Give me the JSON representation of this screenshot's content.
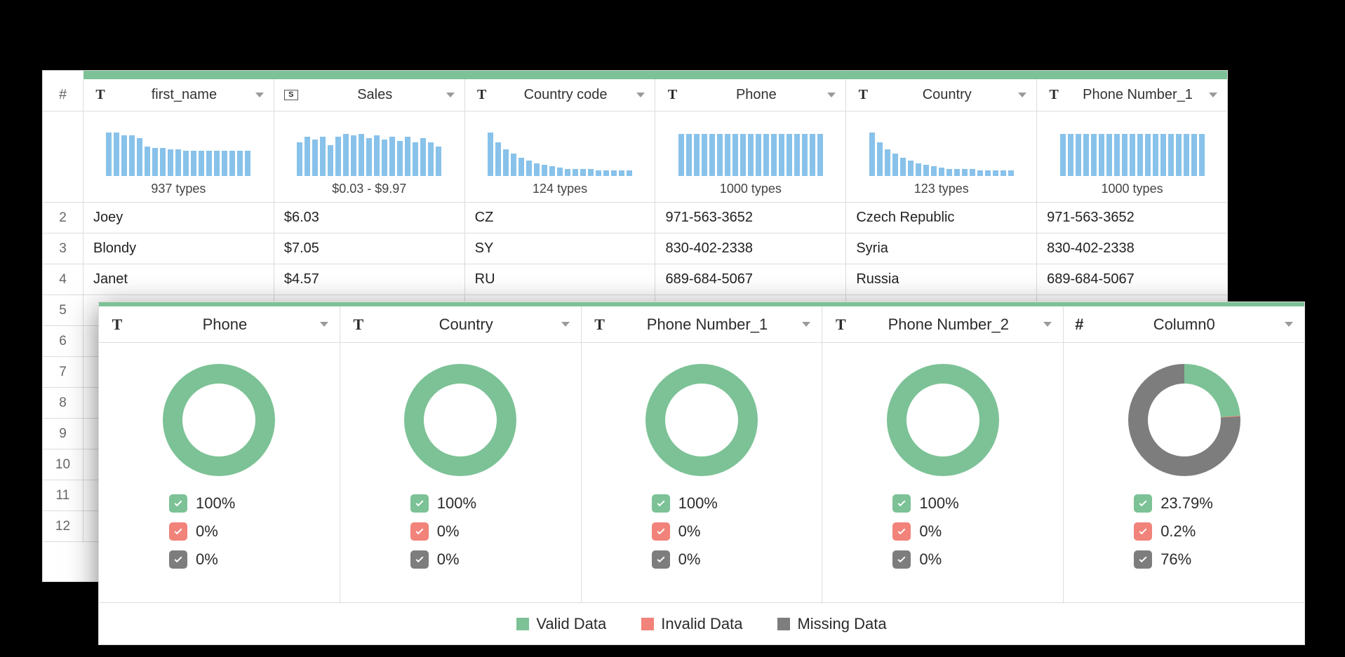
{
  "back": {
    "hash": "#",
    "columns": [
      {
        "type": "T",
        "name": "first_name",
        "hist": [
          62,
          62,
          58,
          58,
          54,
          42,
          40,
          40,
          38,
          38,
          36,
          36,
          36,
          36,
          36,
          36,
          36,
          36,
          36
        ],
        "label": "937 types"
      },
      {
        "type": "S",
        "name": "Sales",
        "hist": [
          48,
          56,
          52,
          56,
          44,
          56,
          60,
          58,
          60,
          54,
          58,
          52,
          56,
          50,
          56,
          48,
          54,
          48,
          42
        ],
        "label": "$0.03 - $9.97"
      },
      {
        "type": "T",
        "name": "Country code",
        "hist": [
          62,
          48,
          38,
          32,
          26,
          22,
          18,
          16,
          14,
          12,
          10,
          10,
          10,
          10,
          8,
          8,
          8,
          8,
          8
        ],
        "label": "124 types"
      },
      {
        "type": "T",
        "name": "Phone",
        "hist": [
          60,
          60,
          60,
          60,
          60,
          60,
          60,
          60,
          60,
          60,
          60,
          60,
          60,
          60,
          60,
          60,
          60,
          60,
          60
        ],
        "label": "1000 types"
      },
      {
        "type": "T",
        "name": "Country",
        "hist": [
          62,
          48,
          38,
          32,
          26,
          22,
          18,
          16,
          14,
          12,
          10,
          10,
          10,
          10,
          8,
          8,
          8,
          8,
          8
        ],
        "label": "123 types"
      },
      {
        "type": "T",
        "name": "Phone Number_1",
        "hist": [
          60,
          60,
          60,
          60,
          60,
          60,
          60,
          60,
          60,
          60,
          60,
          60,
          60,
          60,
          60,
          60,
          60,
          60,
          60
        ],
        "label": "1000 types"
      }
    ],
    "rows": [
      {
        "n": "2",
        "cells": [
          "Joey",
          "$6.03",
          "CZ",
          "971-563-3652",
          "Czech Republic",
          "971-563-3652"
        ]
      },
      {
        "n": "3",
        "cells": [
          "Blondy",
          "$7.05",
          "SY",
          "830-402-2338",
          "Syria",
          "830-402-2338"
        ]
      },
      {
        "n": "4",
        "cells": [
          "Janet",
          "$4.57",
          "RU",
          "689-684-5067",
          "Russia",
          "689-684-5067"
        ]
      }
    ],
    "emptyRows": [
      "5",
      "6",
      "7",
      "8",
      "9",
      "10",
      "11",
      "12"
    ]
  },
  "front": {
    "columns": [
      {
        "type": "T",
        "name": "Phone",
        "valid": 100,
        "invalid": 0,
        "missing": 0,
        "validLabel": "100%",
        "invalidLabel": "0%",
        "missingLabel": "0%"
      },
      {
        "type": "T",
        "name": "Country",
        "valid": 100,
        "invalid": 0,
        "missing": 0,
        "validLabel": "100%",
        "invalidLabel": "0%",
        "missingLabel": "0%"
      },
      {
        "type": "T",
        "name": "Phone Number_1",
        "valid": 100,
        "invalid": 0,
        "missing": 0,
        "validLabel": "100%",
        "invalidLabel": "0%",
        "missingLabel": "0%"
      },
      {
        "type": "T",
        "name": "Phone Number_2",
        "valid": 100,
        "invalid": 0,
        "missing": 0,
        "validLabel": "100%",
        "invalidLabel": "0%",
        "missingLabel": "0%"
      },
      {
        "type": "#",
        "name": "Column0",
        "valid": 23.79,
        "invalid": 0.2,
        "missing": 76,
        "validLabel": "23.79%",
        "invalidLabel": "0.2%",
        "missingLabel": "76%"
      }
    ],
    "legend": {
      "valid": "Valid Data",
      "invalid": "Invalid Data",
      "missing": "Missing Data"
    }
  },
  "chart_data": [
    {
      "type": "bar",
      "title": "first_name distribution",
      "values": [
        62,
        62,
        58,
        58,
        54,
        42,
        40,
        40,
        38,
        38,
        36,
        36,
        36,
        36,
        36,
        36,
        36,
        36,
        36
      ],
      "label": "937 types"
    },
    {
      "type": "bar",
      "title": "Sales distribution",
      "values": [
        48,
        56,
        52,
        56,
        44,
        56,
        60,
        58,
        60,
        54,
        58,
        52,
        56,
        50,
        56,
        48,
        54,
        48,
        42
      ],
      "label": "$0.03 - $9.97"
    },
    {
      "type": "bar",
      "title": "Country code distribution",
      "values": [
        62,
        48,
        38,
        32,
        26,
        22,
        18,
        16,
        14,
        12,
        10,
        10,
        10,
        10,
        8,
        8,
        8,
        8,
        8
      ],
      "label": "124 types"
    },
    {
      "type": "bar",
      "title": "Phone distribution",
      "values": [
        60,
        60,
        60,
        60,
        60,
        60,
        60,
        60,
        60,
        60,
        60,
        60,
        60,
        60,
        60,
        60,
        60,
        60,
        60
      ],
      "label": "1000 types"
    },
    {
      "type": "bar",
      "title": "Country distribution",
      "values": [
        62,
        48,
        38,
        32,
        26,
        22,
        18,
        16,
        14,
        12,
        10,
        10,
        10,
        10,
        8,
        8,
        8,
        8,
        8
      ],
      "label": "123 types"
    },
    {
      "type": "bar",
      "title": "Phone Number_1 distribution",
      "values": [
        60,
        60,
        60,
        60,
        60,
        60,
        60,
        60,
        60,
        60,
        60,
        60,
        60,
        60,
        60,
        60,
        60,
        60,
        60
      ],
      "label": "1000 types"
    },
    {
      "type": "pie",
      "title": "Phone quality",
      "series": [
        {
          "name": "Valid",
          "value": 100
        },
        {
          "name": "Invalid",
          "value": 0
        },
        {
          "name": "Missing",
          "value": 0
        }
      ]
    },
    {
      "type": "pie",
      "title": "Country quality",
      "series": [
        {
          "name": "Valid",
          "value": 100
        },
        {
          "name": "Invalid",
          "value": 0
        },
        {
          "name": "Missing",
          "value": 0
        }
      ]
    },
    {
      "type": "pie",
      "title": "Phone Number_1 quality",
      "series": [
        {
          "name": "Valid",
          "value": 100
        },
        {
          "name": "Invalid",
          "value": 0
        },
        {
          "name": "Missing",
          "value": 0
        }
      ]
    },
    {
      "type": "pie",
      "title": "Phone Number_2 quality",
      "series": [
        {
          "name": "Valid",
          "value": 100
        },
        {
          "name": "Invalid",
          "value": 0
        },
        {
          "name": "Missing",
          "value": 0
        }
      ]
    },
    {
      "type": "pie",
      "title": "Column0 quality",
      "series": [
        {
          "name": "Valid",
          "value": 23.79
        },
        {
          "name": "Invalid",
          "value": 0.2
        },
        {
          "name": "Missing",
          "value": 76
        }
      ]
    }
  ]
}
